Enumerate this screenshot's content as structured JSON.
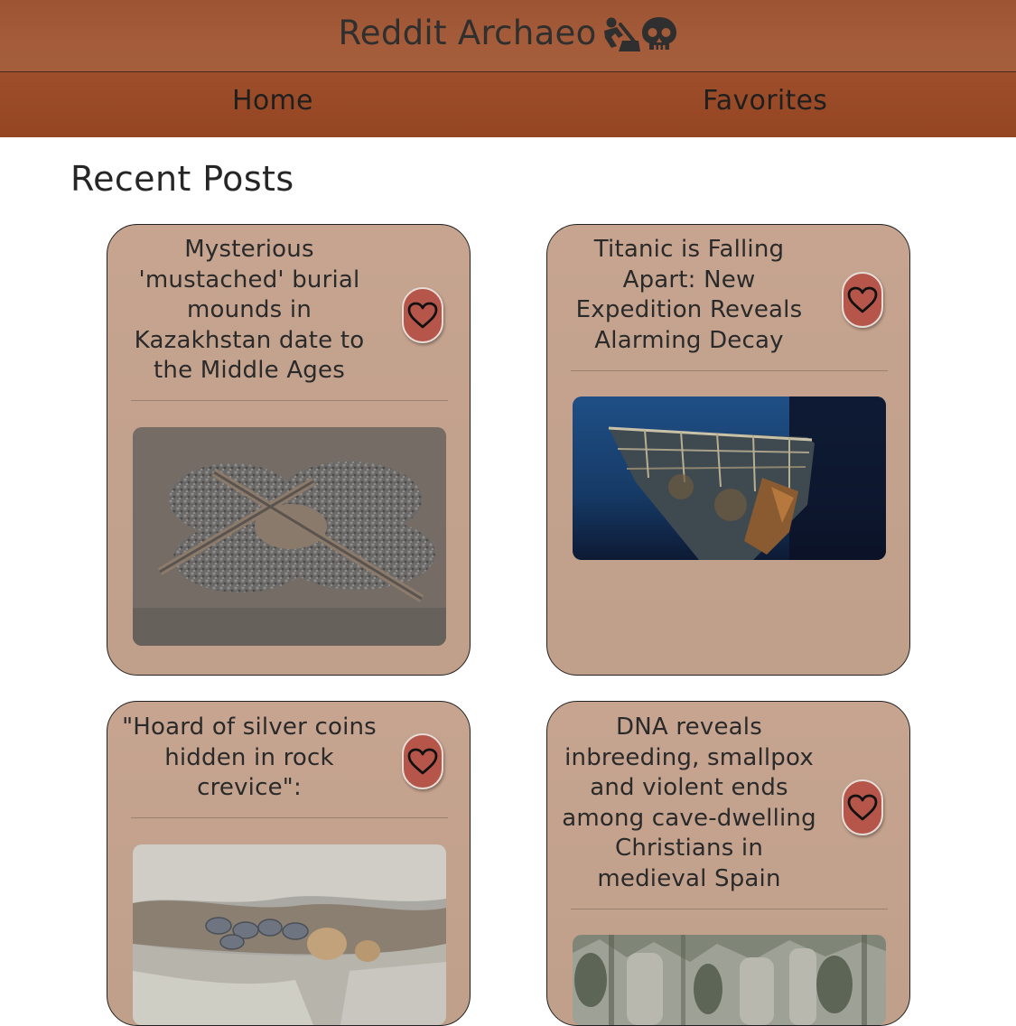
{
  "header": {
    "title": "Reddit Archaeo",
    "icons": [
      "digging-person-icon",
      "skull-icon"
    ]
  },
  "nav": {
    "home_label": "Home",
    "favorites_label": "Favorites"
  },
  "main": {
    "section_title": "Recent Posts"
  },
  "posts": [
    {
      "title": "Mysterious 'mustached' burial mounds in Kazakhstan date to the Middle Ages",
      "favorite_icon": "heart-outline-icon",
      "image": "aerial-burial-mounds-photo"
    },
    {
      "title": "Titanic is Falling Apart: New Expedition Reveals Alarming Decay",
      "favorite_icon": "heart-outline-icon",
      "image": "titanic-bow-wreck-photo"
    },
    {
      "title": "\"Hoard of silver coins hidden in rock crevice\":",
      "favorite_icon": "heart-outline-icon",
      "image": "silver-coins-in-rock-photo"
    },
    {
      "title": "DNA reveals inbreeding, smallpox and violent ends among cave-dwelling Christians in medieval Spain",
      "favorite_icon": "heart-outline-icon",
      "image": "cave-dwellings-cliff-photo"
    }
  ],
  "colors": {
    "header_bg": "#a45b39",
    "nav_bg": "#984924",
    "card_bg": "#c4a28d",
    "favorite_button": "#b6564a"
  }
}
